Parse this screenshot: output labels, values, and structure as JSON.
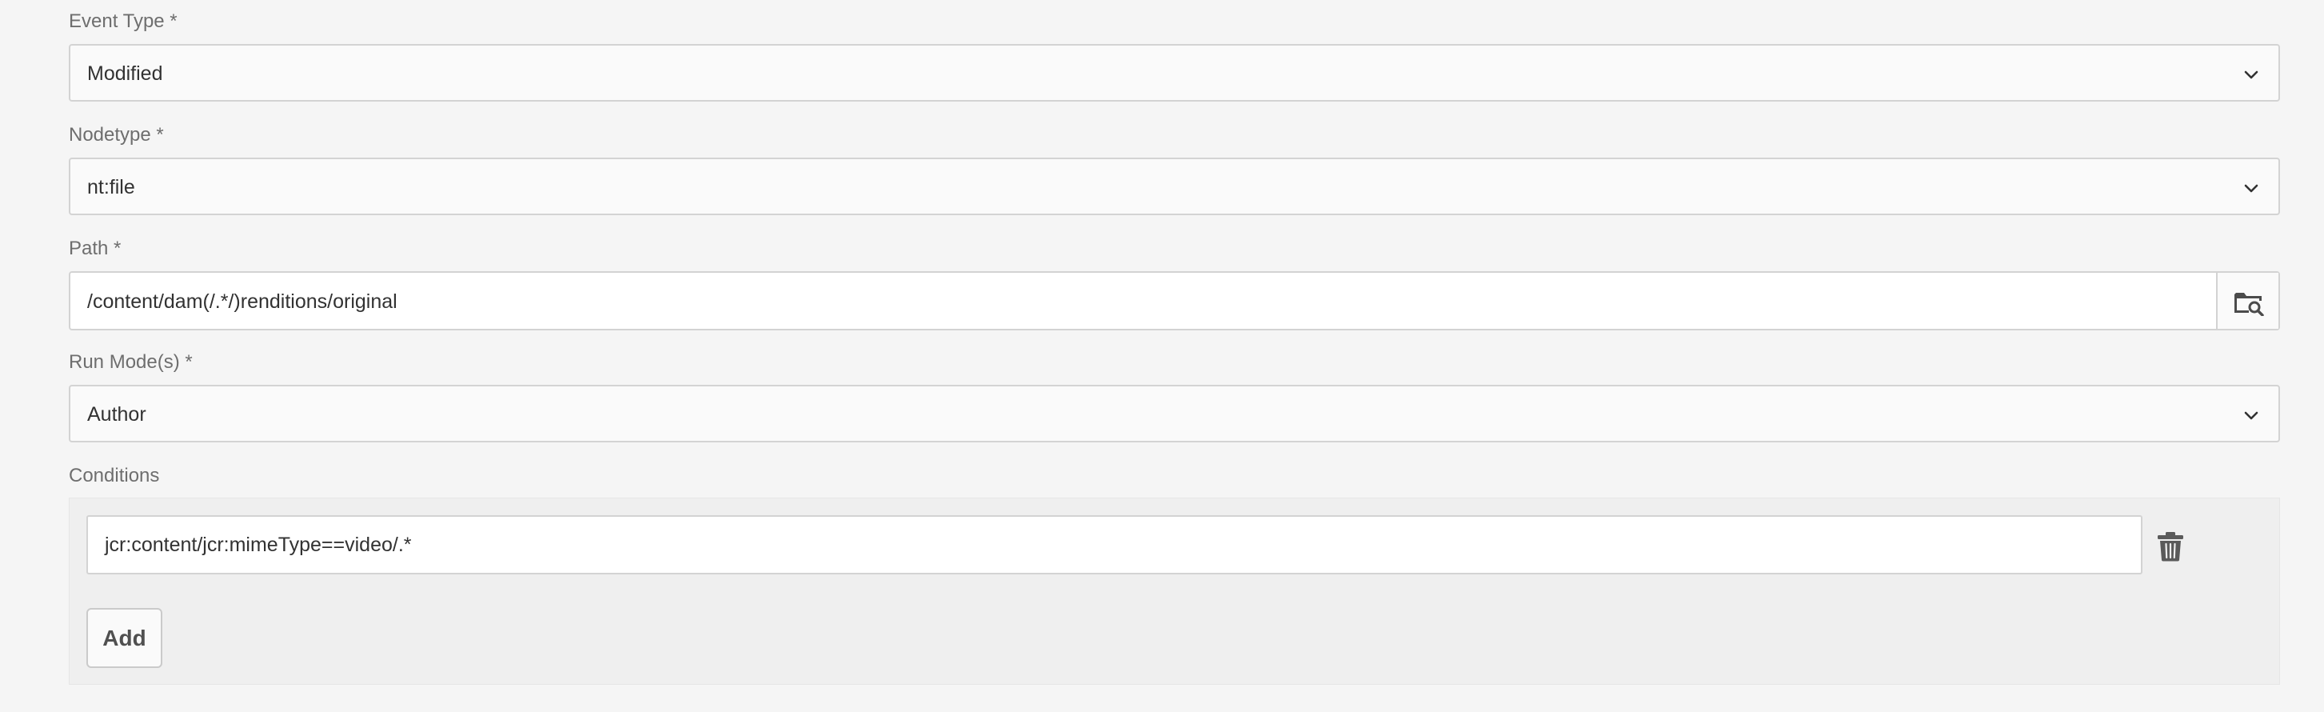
{
  "fields": {
    "event_type": {
      "label": "Event Type *",
      "value": "Modified"
    },
    "nodetype": {
      "label": "Nodetype *",
      "value": "nt:file"
    },
    "path": {
      "label": "Path *",
      "value": "/content/dam(/.*/)renditions/original"
    },
    "run_modes": {
      "label": "Run Mode(s) *",
      "value": "Author"
    }
  },
  "conditions": {
    "label": "Conditions",
    "items": [
      {
        "value": "jcr:content/jcr:mimeType==video/.*"
      }
    ],
    "add_label": "Add"
  },
  "icons": {
    "select_toggle": "chevron-down-icon",
    "path_browse": "folder-search-icon",
    "remove_condition": "trash-icon"
  },
  "colors": {
    "page_background": "#f5f5f5",
    "field_border": "#d3d3d3",
    "label_text": "#6e6e6e",
    "value_text": "#323232"
  }
}
